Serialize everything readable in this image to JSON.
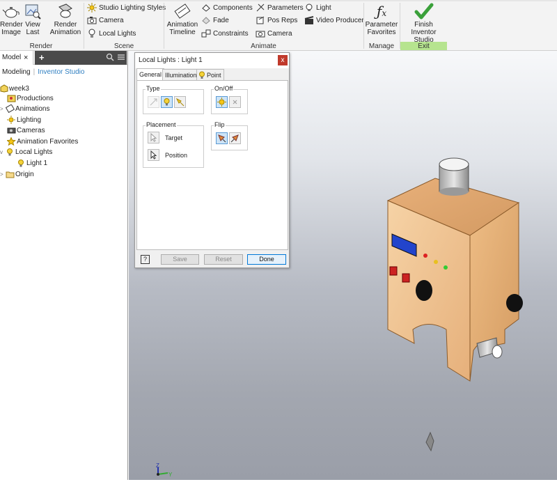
{
  "ribbon": {
    "render": {
      "group_label": "Render",
      "render_image_line1": "Render",
      "render_image_line2": "Image",
      "view_last_line1": "View",
      "view_last_line2": "Last",
      "render_animation_line1": "Render",
      "render_animation_line2": "Animation"
    },
    "scene": {
      "group_label": "Scene",
      "studio_lighting_styles": "Studio Lighting Styles",
      "camera": "Camera",
      "local_lights": "Local Lights"
    },
    "animate": {
      "group_label": "Animate",
      "animation_timeline_line1": "Animation",
      "animation_timeline_line2": "Timeline",
      "components": "Components",
      "fade": "Fade",
      "constraints": "Constraints",
      "parameters": "Parameters",
      "pos_reps": "Pos Reps",
      "camera": "Camera",
      "light": "Light",
      "video_producer": "Video Producer"
    },
    "manage": {
      "group_label": "Manage",
      "parameter_favorites_line1": "Parameter",
      "parameter_favorites_line2": "Favorites"
    },
    "exit": {
      "group_label": "Exit",
      "finish_line1": "Finish",
      "finish_line2": "Inventor Studio"
    }
  },
  "browser": {
    "tab_label": "Model",
    "tab_close": "×",
    "add_tab": "+",
    "mode_modeling": "Modeling",
    "mode_separator": "|",
    "mode_studio": "Inventor Studio",
    "tree": [
      {
        "label": "week3",
        "expander": ""
      },
      {
        "label": "Productions",
        "expander": ""
      },
      {
        "label": "Animations",
        "expander": ">"
      },
      {
        "label": "Lighting",
        "expander": ""
      },
      {
        "label": "Cameras",
        "expander": ""
      },
      {
        "label": "Animation Favorites",
        "expander": ""
      },
      {
        "label": "Local Lights",
        "expander": "v"
      },
      {
        "label": "Light 1",
        "expander": ""
      },
      {
        "label": "Origin",
        "expander": ">"
      }
    ]
  },
  "dialog": {
    "title": "Local Lights : Light 1",
    "close": "x",
    "tabs": [
      "General",
      "Illumination",
      "Point"
    ],
    "type_label": "Type",
    "onoff_label": "On/Off",
    "placement_label": "Placement",
    "target_label": "Target",
    "position_label": "Position",
    "flip_label": "Flip",
    "help": "?",
    "save": "Save",
    "reset": "Reset",
    "done": "Done"
  },
  "viewport": {
    "axis_z": "Z",
    "axis_y": "Y"
  },
  "colors": {
    "exit_accent": "#b6e48f",
    "studio_link": "#2f7fc1",
    "close_red": "#c0392b",
    "wood": "#f3c795"
  }
}
